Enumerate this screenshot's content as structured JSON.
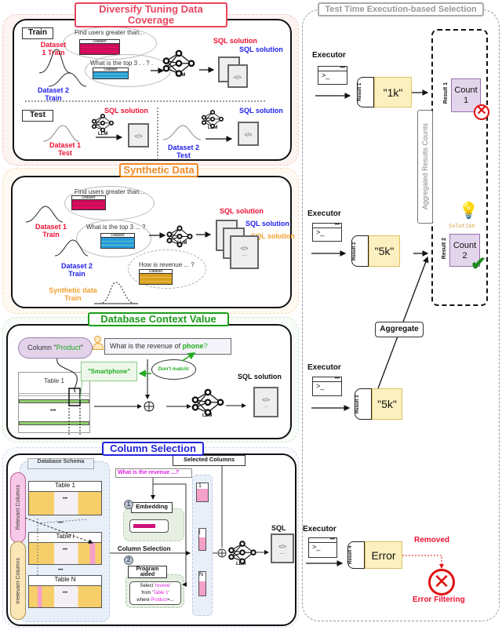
{
  "right": {
    "title": "Test Time Execution-based Selection",
    "executor_label": "Executor",
    "prompt_glyph": ">_",
    "results": [
      {
        "tag": "Result 1",
        "value": "\"1k\""
      },
      {
        "tag": "Result 2",
        "value": "\"5k\""
      },
      {
        "tag": "Result 3",
        "value": "\"5k\""
      },
      {
        "tag": "Result 4",
        "value": "Error"
      }
    ],
    "aggregated_label": "Aggregated Results Counts",
    "aggregate_label": "Aggregate",
    "counts": [
      {
        "tag": "Result 1",
        "label": "Count",
        "n": "1"
      },
      {
        "tag": "Result 2",
        "label": "Count",
        "n": "2"
      }
    ],
    "solution_label": "Solution",
    "removed_label": "Removed",
    "error_filtering_label": "Error Filtering"
  },
  "diversify": {
    "title": "Diversify Tuning Data Coverage",
    "train_label": "Train",
    "test_label": "Test",
    "q1": "Find users greater than...",
    "q2": "What is the top 3 . . ? .",
    "dataset_label": "Dataset",
    "d1_train": "Dataset 1 Train",
    "d2_train": "Dataset 2 Train",
    "d1_test": "Dataset 1 Test",
    "d2_test": "Dataset 2 Test",
    "sql_solution": "SQL solution",
    "llm": "LLM",
    "code": "</>"
  },
  "synthetic": {
    "title": "Synthetic Data",
    "q1": "Find users greater than...",
    "q2": "What is the top 3 ... ?",
    "q3": "How is revenue ... ?",
    "dataset_label": "Dataset",
    "d1_train": "Dataset 1 Train",
    "d2_train": "Dataset 2 Train",
    "syn_train": "Synthetic data Train",
    "sql_solution": "SQL solution",
    "llm": "LLM",
    "code": "</>",
    "ellipsis": "..."
  },
  "context": {
    "title": "Database Context Value",
    "column_prefix": "Column \"",
    "column_name": "Product",
    "column_suffix": "\"",
    "question_prefix": "What is the revenue of ",
    "question_keyword": "phone",
    "question_suffix": "?",
    "dont_match": "Don't match!",
    "smartphone": "\"Smartphone\"",
    "table": "Table 1",
    "dots": "•••",
    "sql_solution": "SQL solution",
    "llm": "LLM",
    "code": "</>",
    "ellipsis": "..."
  },
  "colsel": {
    "title": "Column Selection",
    "schema_label": "Database Schema",
    "relevant": "Relevant Columns",
    "irrelevant": "Irrelevant Columns",
    "tables": [
      "Table 1",
      "Table i",
      "Table N"
    ],
    "dots": "•••",
    "query": "What is the revenue ...?",
    "embedding_num": "1",
    "embedding": "Embedding",
    "column_selection": "Column Selection",
    "program_num": "2",
    "program": "Program aided",
    "sql_line1_a": "Select '",
    "sql_line1_b": "revene",
    "sql_line1_c": "'",
    "sql_line2_a": "from '",
    "sql_line2_b": "Table 1",
    "sql_line2_c": "'",
    "sql_line3_a": "where ",
    "sql_line3_b": "Product",
    "sql_line3_c": "=...",
    "selected_columns": "Selected Columns",
    "sel": [
      "1",
      "j",
      "N"
    ],
    "sql": "SQL",
    "llm": "LLM",
    "code": "</>",
    "ellipsis": "..."
  },
  "colors": {
    "diversify": "#e8455f",
    "synthetic": "#f08a24",
    "context": "#1a9e1a",
    "colsel": "#2222dd",
    "right": "#999999"
  }
}
